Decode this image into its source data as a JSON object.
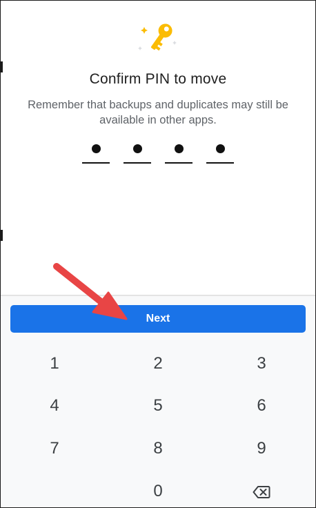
{
  "dialog": {
    "icon": "key-icon",
    "title": "Confirm PIN to move",
    "subtitle": "Remember that backups and duplicates may still be available in other apps."
  },
  "pin": {
    "length": 4,
    "filled": 4
  },
  "actions": {
    "next_label": "Next"
  },
  "keypad": {
    "keys": [
      "1",
      "2",
      "3",
      "4",
      "5",
      "6",
      "7",
      "8",
      "9",
      "0"
    ],
    "backspace_icon": "backspace-icon"
  },
  "colors": {
    "accent": "#1a73e8",
    "key_icon": "#fbbc04",
    "arrow": "#e84545",
    "keypad_background": "#f8f9fa"
  }
}
